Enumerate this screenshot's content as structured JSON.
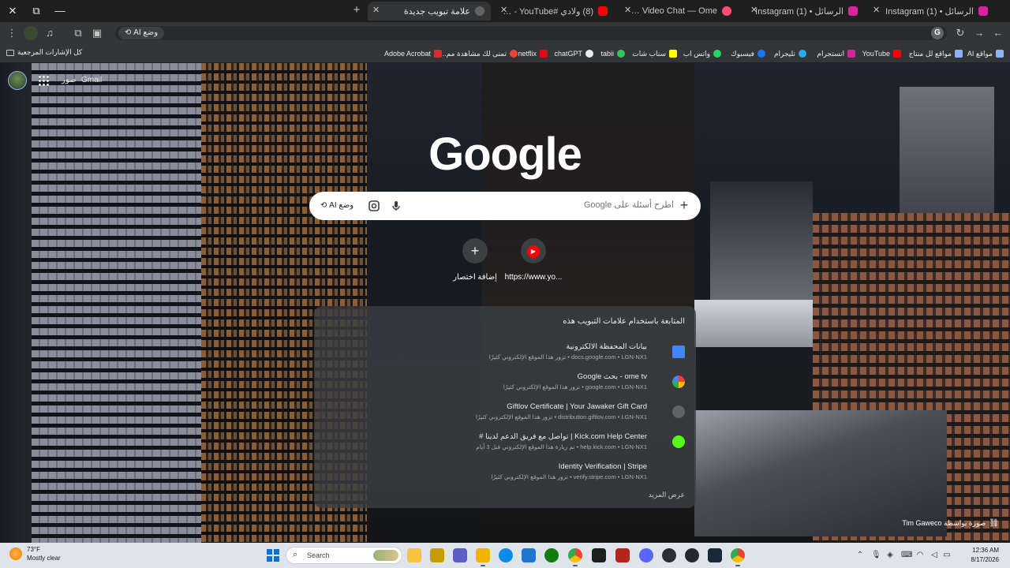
{
  "window_controls": {
    "close": "✕",
    "maximize": "⧉",
    "minimize": "—"
  },
  "tabs": [
    {
      "title": "الرسائل • (1) Instagram",
      "fav_color": "#d6249f",
      "active": false
    },
    {
      "title": "الرسائل • (1) Instagram",
      "fav_color": "#d6249f",
      "active": false
    },
    {
      "title": "OmeTV Video Chat — Ome",
      "fav_color": "#ff4d6d",
      "active": false
    },
    {
      "title": "(8) ولادي #shorts - YouTube",
      "fav_color": "#ff0000",
      "active": false
    },
    {
      "title": "علامة تبويب جديدة",
      "fav_color": "#5f6368",
      "active": true
    }
  ],
  "new_tab_label": "+",
  "toolbar": {
    "back_icon": "arrow-left-icon",
    "forward_icon": "arrow-right-icon",
    "reload_icon": "reload-icon",
    "omnibox_value": "",
    "ai_mode_label": "وضع AI",
    "google_button_label": "G"
  },
  "bookmarks": [
    {
      "label": "مواقع AI",
      "color": "#8ab4f8"
    },
    {
      "label": "مواقع لل منتاج",
      "color": "#8ab4f8"
    },
    {
      "label": "YouTube",
      "color": "#ff0000"
    },
    {
      "label": "انستجرام",
      "color": "#d6249f"
    },
    {
      "label": "تليجرام",
      "color": "#2aabee"
    },
    {
      "label": "فيسبوك",
      "color": "#1877f2"
    },
    {
      "label": "واتس اب",
      "color": "#25d366"
    },
    {
      "label": "سناب شات",
      "color": "#fffc00"
    },
    {
      "label": "tabii",
      "color": "#34c759"
    },
    {
      "label": "chatGPT",
      "color": "#e8eaed"
    },
    {
      "label": "netflix",
      "color": "#e50914"
    },
    {
      "label": "تمنى لك مشاهدة مم...",
      "color": "#ea4335"
    },
    {
      "label": "Adobe Acrobat",
      "color": "#d32f2f"
    }
  ],
  "all_bookmarks_label": "كل الإشارات المرجعية",
  "ntp": {
    "gmail_label": "Gmail",
    "images_label": "صور",
    "logo_text": "Google",
    "search_placeholder": "اطرح أسئلة على Google",
    "ai_mode_button": "وضع AI",
    "shortcuts": [
      {
        "label": "https://www.yo...",
        "icon": "youtube-icon"
      },
      {
        "label": "إضافة اختصار",
        "icon": "+"
      }
    ],
    "history_title": "المتابعة باستخدام علامات التبويب هذه",
    "history_items": [
      {
        "title": "بيانات المحفظة الالكترونية",
        "subtitle": "docs.google.com • LGN-NX1 • تزور هذا الموقع الإلكتروني كثيرًا",
        "icon_color": "#4285f4"
      },
      {
        "title": "ome tv - بحث Google",
        "subtitle": "google.com • LGN-NX1 • تزور هذا الموقع الإلكتروني كثيرًا",
        "icon_color": "#ffffff"
      },
      {
        "title": "Giftlov Certificate | Your Jawaker Gift Card",
        "subtitle": "distribution.giftlov.com • LGN-NX1 • تزور هذا الموقع الإلكتروني كثيرًا",
        "icon_color": "#5f6368"
      },
      {
        "title": "Kick.com Help Center | تواصل مع فريق الدعم لدينا #",
        "subtitle": "help.kick.com • LGN-NX1 • تم زيارة هذا الموقع الإلكتروني قبل 3 أيام",
        "icon_color": "#53fc18"
      },
      {
        "title": "Identity Verification | Stripe",
        "subtitle": "verify.stripe.com • LGN-NX1 • تزور هذا الموقع الإلكتروني كثيرًا",
        "icon_color": "#635bff"
      }
    ],
    "show_more": "عرض المزيد",
    "photo_credit": "صورة بواسطة Tim Gaweco"
  },
  "taskbar": {
    "weather_temp": "73°F",
    "weather_cond": "Mostly clear",
    "search_label": "Search",
    "apps": [
      {
        "name": "file-explorer",
        "color": "#f5c542"
      },
      {
        "name": "app-r",
        "color": "#c89b00"
      },
      {
        "name": "teams",
        "color": "#5b5fc7"
      },
      {
        "name": "folder",
        "color": "#f3b400"
      },
      {
        "name": "edge",
        "color": "#0c8ce9"
      },
      {
        "name": "store",
        "color": "#1f76d2"
      },
      {
        "name": "xbox",
        "color": "#107c10"
      },
      {
        "name": "chrome",
        "color": "#34a853"
      },
      {
        "name": "terminal",
        "color": "#1e1e1e"
      },
      {
        "name": "media-app",
        "color": "#b3261e"
      },
      {
        "name": "discord",
        "color": "#5865f2"
      },
      {
        "name": "obs",
        "color": "#302e31"
      },
      {
        "name": "app-dark",
        "color": "#24292e"
      },
      {
        "name": "steam",
        "color": "#1b2838"
      },
      {
        "name": "chrome-active",
        "color": "#4285f4"
      }
    ],
    "clock_time": "12:36 AM",
    "clock_date": "8/17/2026"
  }
}
